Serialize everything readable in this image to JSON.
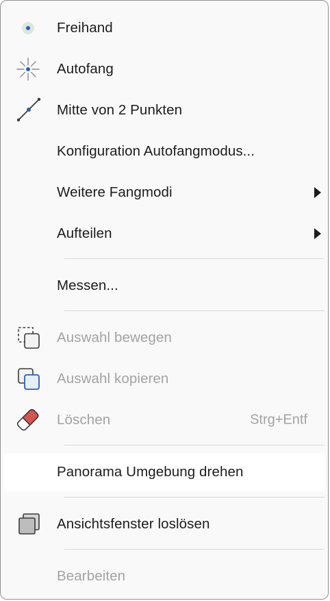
{
  "menu": {
    "items": [
      {
        "label": "Freihand",
        "icon": "freehand-dot-icon"
      },
      {
        "label": "Autofang",
        "icon": "autosnap-burst-icon"
      },
      {
        "label": "Mitte von 2 Punkten",
        "icon": "midpoint-line-icon"
      },
      {
        "label": "Konfiguration Autofangmodus..."
      },
      {
        "label": "Weitere Fangmodi",
        "submenu": true
      },
      {
        "label": "Aufteilen",
        "submenu": true
      },
      {
        "label": "Messen..."
      },
      {
        "label": "Auswahl bewegen",
        "icon": "move-selection-icon",
        "disabled": true
      },
      {
        "label": "Auswahl kopieren",
        "icon": "copy-selection-icon",
        "disabled": true
      },
      {
        "label": "Löschen",
        "icon": "eraser-icon",
        "shortcut": "Strg+Entf",
        "disabled": true
      },
      {
        "label": "Panorama Umgebung drehen",
        "hovered": true
      },
      {
        "label": "Ansichtsfenster loslösen",
        "icon": "detach-viewport-icon"
      },
      {
        "label": "Bearbeiten",
        "disabled": true
      }
    ]
  },
  "colors": {
    "accent_blue": "#2b5fb3",
    "eraser_red": "#d9534f",
    "disabled_text": "#a3a3a3"
  }
}
